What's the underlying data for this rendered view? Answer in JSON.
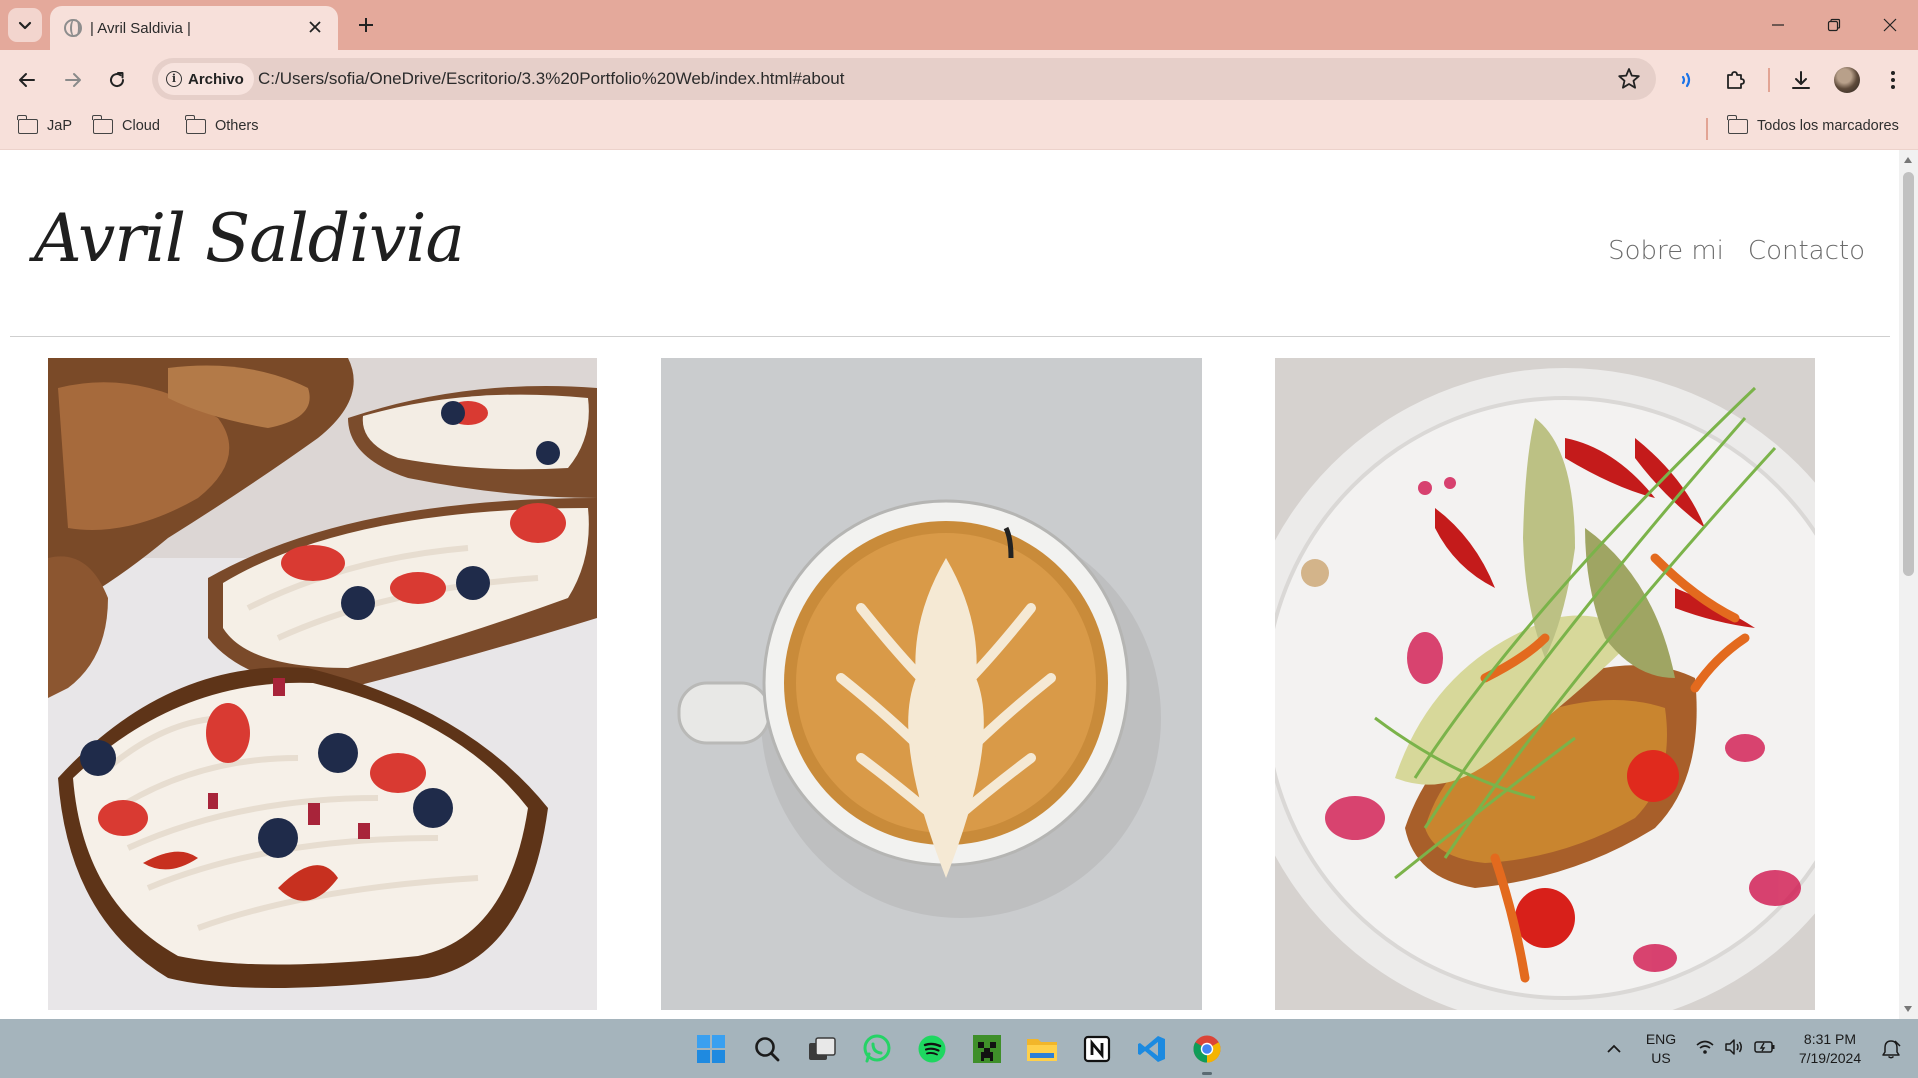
{
  "browser": {
    "tab": {
      "title": "| Avril Saldivia |"
    },
    "omnibox": {
      "chip_label": "Archivo",
      "url": "C:/Users/sofia/OneDrive/Escritorio/3.3%20Portfolio%20Web/index.html#about"
    },
    "bookmarks": [
      {
        "label": "JaP"
      },
      {
        "label": "Cloud"
      },
      {
        "label": "Others"
      }
    ],
    "all_bookmarks_label": "Todos los marcadores"
  },
  "page": {
    "logo": "Avril Saldivia",
    "nav": [
      {
        "label": "Sobre mi"
      },
      {
        "label": "Contacto"
      }
    ],
    "gallery": [
      {
        "subject": "croissant toasts with cream, strawberries and blueberries"
      },
      {
        "subject": "latte art coffee cup"
      },
      {
        "subject": "avocado salad plate with vegetables and sprouts"
      }
    ]
  },
  "taskbar": {
    "apps": [
      "start-icon",
      "search-icon",
      "task-view-icon",
      "whatsapp-icon",
      "spotify-icon",
      "minecraft-icon",
      "file-explorer-icon",
      "notion-icon",
      "vscode-icon",
      "chrome-icon"
    ],
    "language": {
      "line1": "ENG",
      "line2": "US"
    },
    "clock": {
      "time": "8:31 PM",
      "date": "7/19/2024"
    }
  },
  "colors": {
    "tabstrip": "#e4a99b",
    "toolbar": "#f7e0da",
    "omnibox": "#e6cfc9",
    "taskbar": "#a5b4bc",
    "nav_text": "#6b6b6b"
  }
}
